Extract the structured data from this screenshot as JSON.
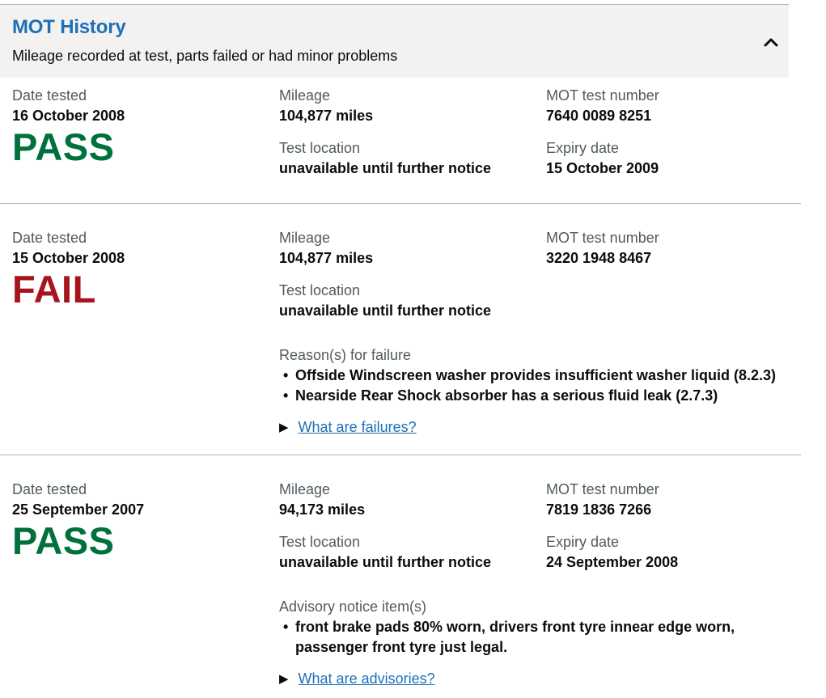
{
  "panel": {
    "title": "MOT History",
    "subtitle": "Mileage recorded at test, parts failed or had minor problems",
    "toggle_icon": "chevron-up-icon"
  },
  "labels": {
    "date_tested": "Date tested",
    "mileage": "Mileage",
    "test_number": "MOT test number",
    "test_location": "Test location",
    "expiry_date": "Expiry date",
    "reasons_failure": "Reason(s) for failure",
    "advisory_items": "Advisory notice item(s)"
  },
  "colors": {
    "pass": "#00703c",
    "fail": "#a6141e",
    "link": "#1d70b8",
    "header_bg": "#f3f2f1"
  },
  "records": [
    {
      "date": "16 October 2008",
      "result": "PASS",
      "mileage": "104,877 miles",
      "test_number": "7640 0089 8251",
      "location": "unavailable until further notice",
      "expiry": "15 October 2009"
    },
    {
      "date": "15 October 2008",
      "result": "FAIL",
      "mileage": "104,877 miles",
      "test_number": "3220 1948 8467",
      "location": "unavailable until further notice",
      "failures": [
        "Offside Windscreen washer provides insufficient washer liquid (8.2.3)",
        "Nearside Rear Shock absorber has a serious fluid leak (2.7.3)"
      ],
      "link": "What are failures?"
    },
    {
      "date": "25 September 2007",
      "result": "PASS",
      "mileage": "94,173 miles",
      "test_number": "7819 1836 7266",
      "location": "unavailable until further notice",
      "expiry": "24 September 2008",
      "advisories_line1": "front brake pads 80% worn, drivers front tyre innear edge worn,",
      "advisories_line2": "passenger front tyre just legal.",
      "link": "What are advisories?"
    }
  ]
}
